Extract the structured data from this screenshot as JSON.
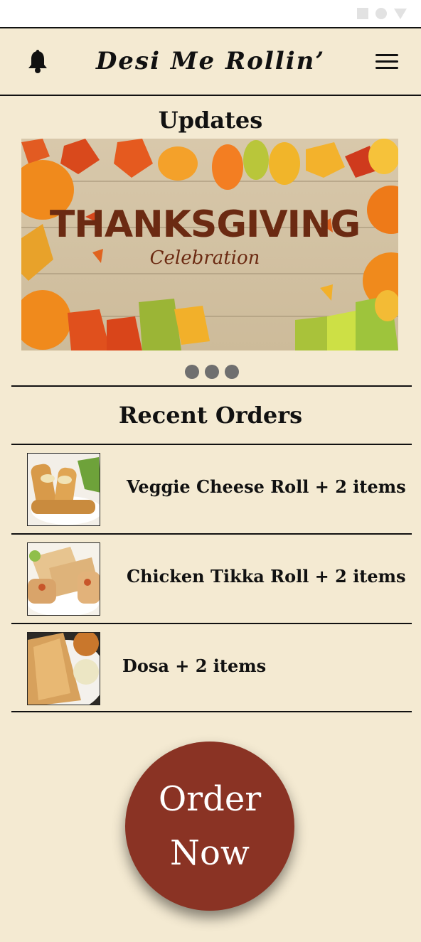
{
  "header": {
    "title": "Desi Me Rollin’",
    "left_icon": "bell-icon",
    "right_icon": "hamburger-menu-icon"
  },
  "updates": {
    "title": "Updates",
    "banner": {
      "headline": "THANKSGIVING",
      "subline": "Celebration"
    },
    "carousel_dots": 3
  },
  "recent_orders": {
    "title": "Recent Orders",
    "items": [
      {
        "label": "Veggie Cheese Roll + 2 items",
        "image": "veggie-cheese-roll-image"
      },
      {
        "label": "Chicken Tikka Roll + 2 items",
        "image": "chicken-tikka-roll-image"
      },
      {
        "label": "Dosa + 2 items",
        "image": "dosa-image"
      }
    ]
  },
  "order_button": {
    "line1": "Order",
    "line2": "Now"
  },
  "colors": {
    "background": "#f4ead2",
    "button": "#8a3324",
    "text": "#111111"
  }
}
